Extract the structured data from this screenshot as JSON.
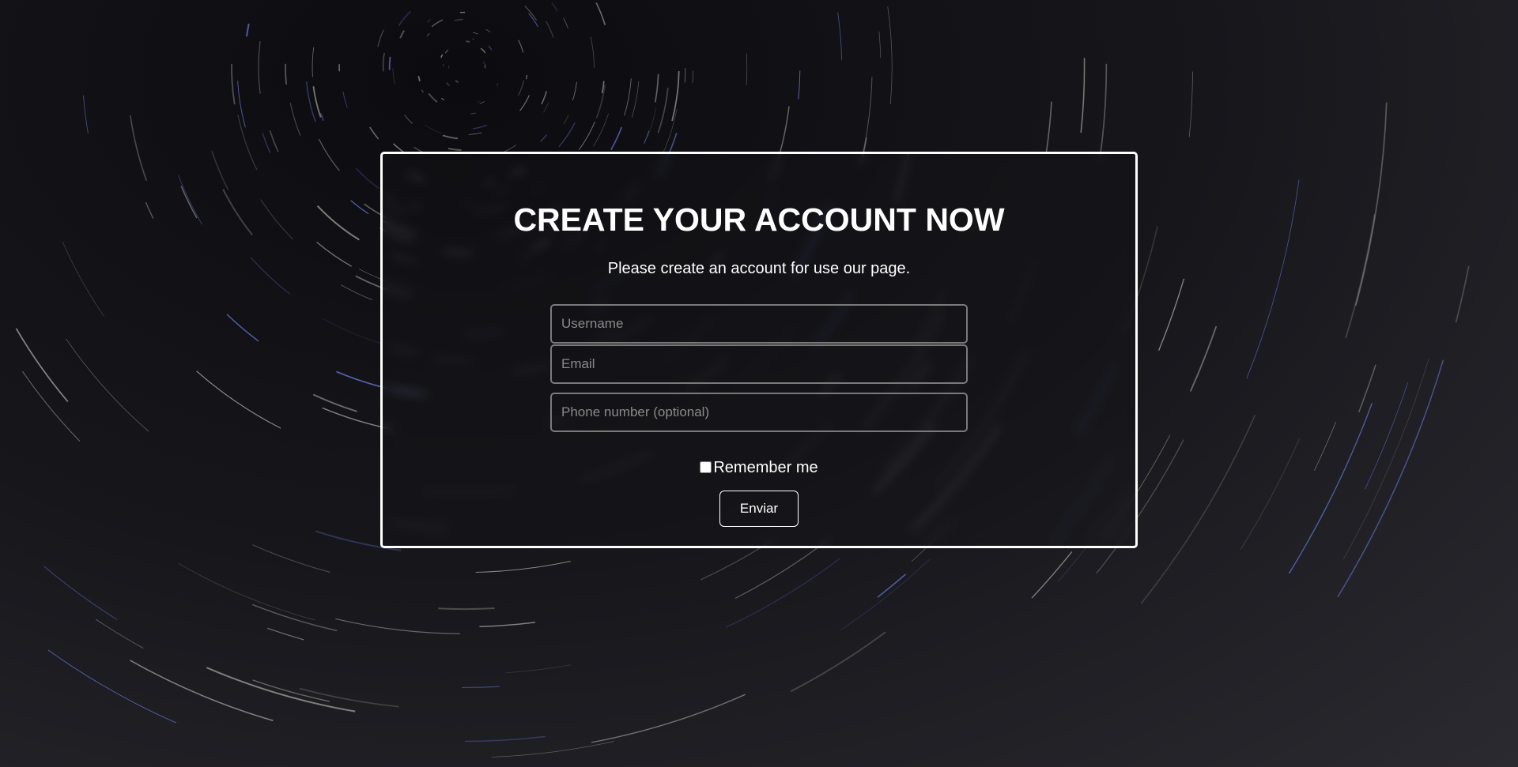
{
  "form": {
    "title": "CREATE YOUR ACCOUNT NOW",
    "subtitle": "Please create an account for use our page.",
    "username_placeholder": "Username",
    "email_placeholder": "Email",
    "phone_placeholder": "Phone number (optional)",
    "remember_label": "Remember me",
    "remember_checked": false,
    "submit_label": "Enviar"
  },
  "colors": {
    "accent": "#ffffff",
    "background": "#141418",
    "trail_blue": "#7b8cff"
  }
}
